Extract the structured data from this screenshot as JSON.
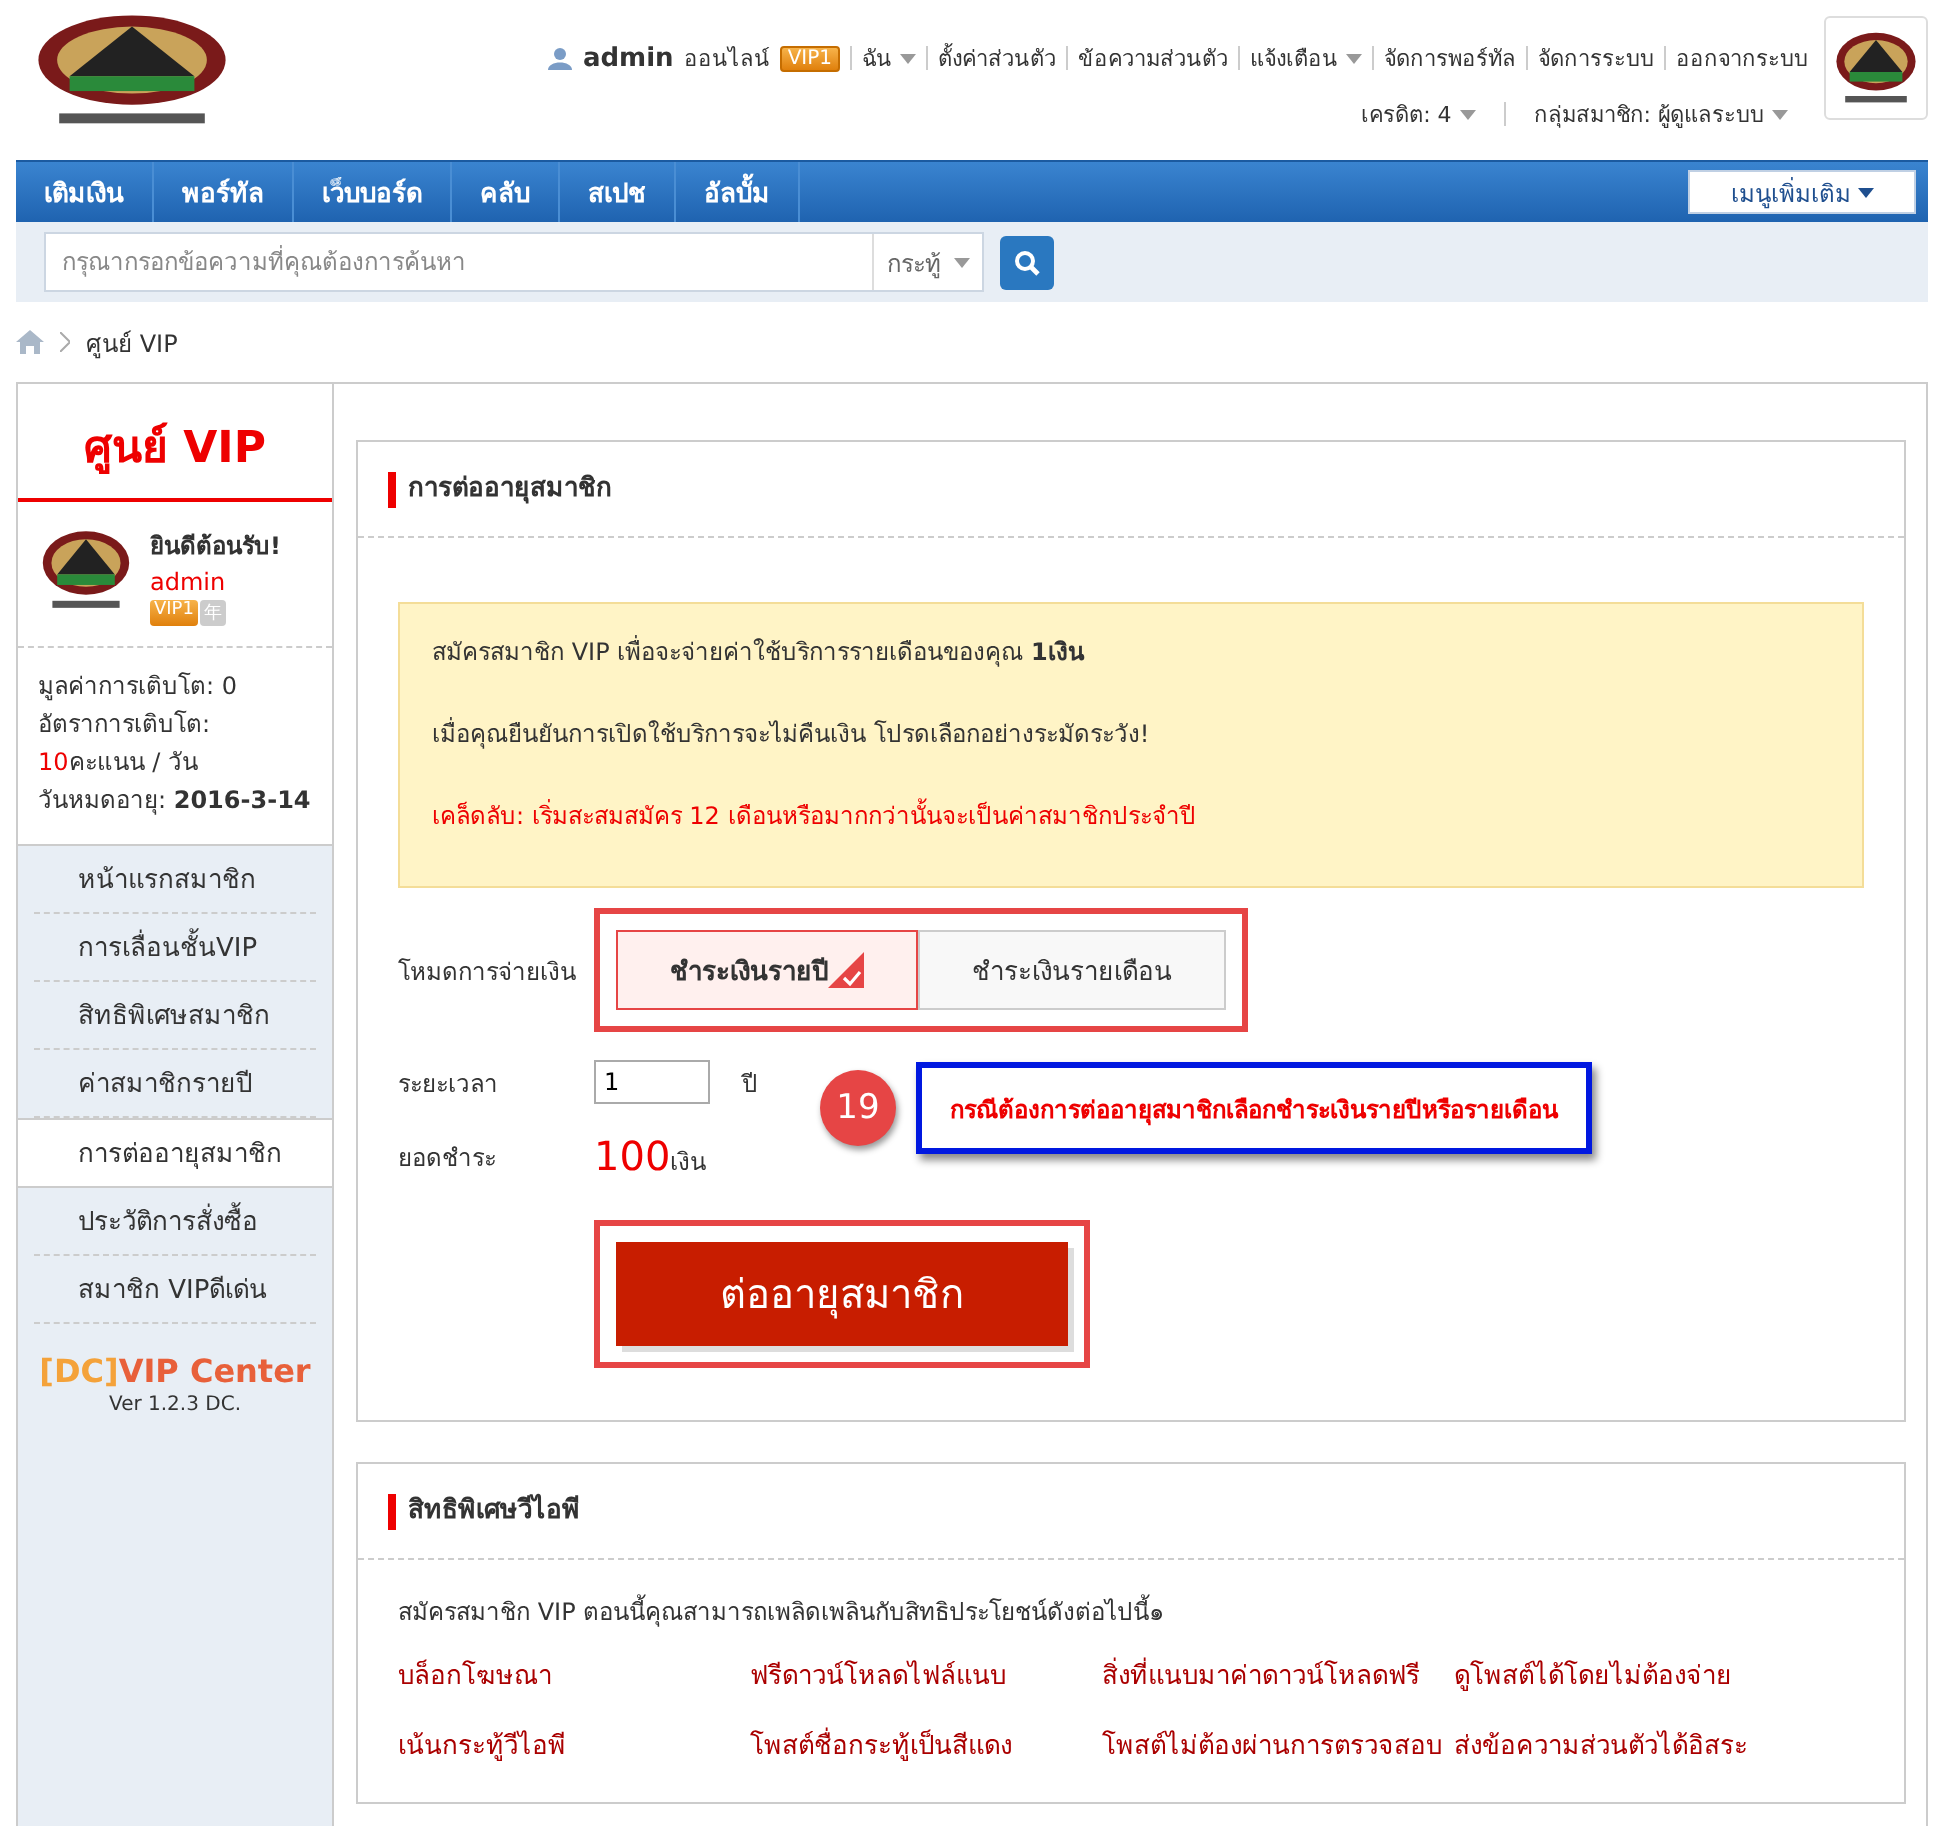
{
  "header": {
    "username": "admin",
    "status": "ออนไลน์",
    "badge": "VIP1",
    "links": [
      {
        "label": "ฉัน",
        "dropdown": true
      },
      {
        "label": "ตั้งค่าส่วนตัว",
        "dropdown": false
      },
      {
        "label": "ข้อความส่วนตัว",
        "dropdown": false
      },
      {
        "label": "แจ้งเตือน",
        "dropdown": true
      },
      {
        "label": "จัดการพอร์ทัล",
        "dropdown": false
      },
      {
        "label": "จัดการระบบ",
        "dropdown": false
      },
      {
        "label": "ออกจากระบบ",
        "dropdown": false
      }
    ],
    "second_row": [
      {
        "label": "เครดิต: 4",
        "dropdown": true
      },
      {
        "label": "กลุ่มสมาชิก: ผู้ดูแลระบบ",
        "dropdown": true
      }
    ]
  },
  "nav": {
    "items": [
      "เติมเงิน",
      "พอร์ทัล",
      "เว็บบอร์ด",
      "คลับ",
      "สเปช",
      "อัลบั้ม"
    ],
    "more": "เมนูเพิ่มเติม"
  },
  "search": {
    "placeholder": "กรุณากรอกข้อความที่คุณต้องการค้นหา",
    "scope": "กระทู้"
  },
  "breadcrumb": [
    "ศูนย์ VIP"
  ],
  "sidebar": {
    "title": "ศูนย์ VIP",
    "welcome": "ยินดีต้อนรับ!",
    "username": "admin",
    "badges": [
      "VIP1",
      "年"
    ],
    "growth": "มูลค่าการเติบโต: 0",
    "rate": {
      "label": "อัตราการเติบโต: ",
      "value": "10",
      "unit": "คะแนน / วัน"
    },
    "expiry": "วันหมดอายุ: **2016-3-14**",
    "menu": [
      {
        "label": "หน้าแรกสมาชิก",
        "selected": false
      },
      {
        "label": "การเลื่อนชั้นVIP",
        "selected": false
      },
      {
        "label": "สิทธิพิเศษสมาชิก",
        "selected": false
      },
      {
        "label": "ค่าสมาชิกรายปี",
        "selected": false
      },
      {
        "label": "การต่ออายุสมาชิก",
        "selected": true
      },
      {
        "label": "ประวัติการสั่งซื้อ",
        "selected": false
      },
      {
        "label": "สมาชิก VIPดีเด่น",
        "selected": false
      }
    ],
    "footer": {
      "prefix": "[DC]",
      "name": "VIP Center",
      "version": "Ver 1.2.3 DC."
    }
  },
  "renew": {
    "title": "การต่ออายุสมาชิก",
    "notices": [
      {
        "kind": "info",
        "text": "สมัครสมาชิก VIP เพื่อจะจ่ายค่าใช้บริการรายเดือนของคุณ **1เงิน**"
      },
      {
        "kind": "info",
        "text": "เมื่อคุณยืนยันการเปิดใช้บริการจะไม่คืนเงิน โปรดเลือกอย่างระมัดระวัง!"
      },
      {
        "kind": "tip",
        "text": "เคล็ดลับ: เริ่มสะสมสมัคร 12 เดือนหรือมากกว่านั้นจะเป็นค่าสมาชิกประจำปี"
      }
    ],
    "mode_label": "โหมดการจ่ายเงิน",
    "modes": [
      {
        "label": "ชำระเงินรายปี",
        "selected": true
      },
      {
        "label": "ชำระเงินรายเดือน",
        "selected": false
      }
    ],
    "duration_label": "ระยะเวลา",
    "duration": "1",
    "duration_unit": "ปี",
    "amount_label": "ยอดชำระ",
    "amount": "100",
    "amount_unit": "เงิน",
    "button": "ต่ออายุสมาชิก"
  },
  "annotation": {
    "number": "19",
    "text": "กรณีต้องการต่ออายุสมาชิกเลือกชำระเงินรายปีหรือรายเดือน"
  },
  "privileges": {
    "title": "สิทธิพิเศษวีไอพี",
    "intro": "สมัครสมาชิก VIP ตอนนี้คุณสามารถเพลิดเพลินกับสิทธิประโยชน์ดังต่อไปนี้๑",
    "items": [
      "บล็อกโฆษณา",
      "ฟรีดาวน์โหลดไฟล์แนบ",
      "สิ่งที่แนบมาค่าดาวน์โหลดฟรี",
      "ดูโพสต์ได้โดยไม่ต้องจ่าย",
      "เน้นกระทู้วีไอพี",
      "โพสต์ชื่อกระทู้เป็นสีแดง",
      "โพสต์ไม่ต้องผ่านการตรวจสอบ",
      "ส่งข้อความส่วนตัวได้อิสระ"
    ]
  }
}
